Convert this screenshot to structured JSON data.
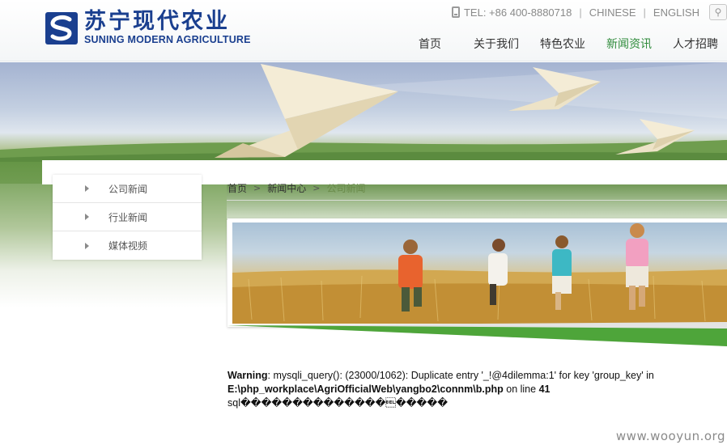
{
  "header": {
    "logo_cn": "苏宁现代农业",
    "logo_en": "SUNING MODERN AGRICULTURE",
    "tel": "TEL: +86 400-8880718",
    "lang_cn": "CHINESE",
    "lang_en": "ENGLISH",
    "separator": "|",
    "icons": {
      "phone": "phone-icon",
      "search": "search-icon",
      "logo": "logo-s-icon"
    }
  },
  "nav": {
    "items": [
      {
        "label": "首页"
      },
      {
        "label": "关于我们"
      },
      {
        "label": "特色农业"
      },
      {
        "label": "新闻资讯"
      },
      {
        "label": "人才招聘"
      }
    ],
    "active_color": "#2e8b3a"
  },
  "sidebar": {
    "items": [
      {
        "label": "公司新闻"
      },
      {
        "label": "行业新闻"
      },
      {
        "label": "媒体视频"
      }
    ]
  },
  "breadcrumb": {
    "items": [
      "首页",
      "新闻中心",
      "公司新闻"
    ],
    "separator": ">"
  },
  "warning": {
    "prefix": "Warning",
    "message": ": mysqli_query(): (23000/1062): Duplicate entry '_!@4dilemma:1' for key 'group_key' in",
    "path": "E:\\php_workplace\\AgriOfficialWeb\\yangbo2\\connm\\b.php",
    "on_line": " on line ",
    "line": "41",
    "sql_line": "sql��������������\u0007�����"
  },
  "watermark": "www.wooyun.org",
  "colors": {
    "brand": "#1a3f8f",
    "accent_green": "#4ea53a"
  }
}
